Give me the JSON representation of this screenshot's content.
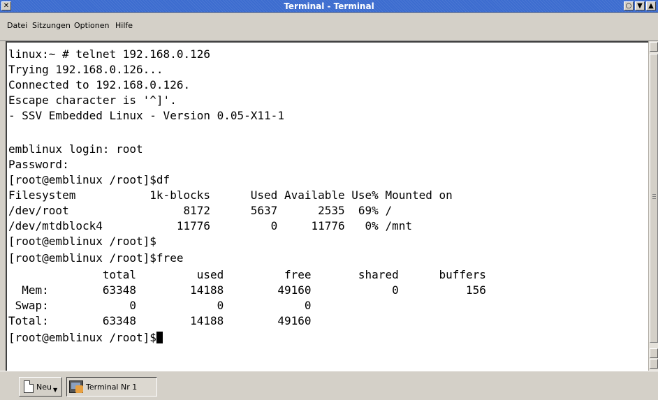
{
  "window": {
    "title": "Terminal - Terminal",
    "close_glyph": "✕",
    "buttons": [
      "○",
      "▼",
      "▲"
    ]
  },
  "menu": {
    "items": [
      "Datei",
      "Sitzungen",
      "Optionen",
      "Hilfe"
    ]
  },
  "terminal": {
    "lines": [
      "linux:~ # telnet 192.168.0.126",
      "Trying 192.168.0.126...",
      "Connected to 192.168.0.126.",
      "Escape character is '^]'.",
      "- SSV Embedded Linux - Version 0.05-X11-1",
      "",
      "emblinux login: root",
      "Password:",
      "[root@emblinux /root]$df",
      "Filesystem           1k-blocks      Used Available Use% Mounted on",
      "/dev/root                 8172      5637      2535  69% /",
      "/dev/mtdblock4           11776         0     11776   0% /mnt",
      "[root@emblinux /root]$",
      "[root@emblinux /root]$free",
      "              total         used         free       shared      buffers",
      "  Mem:        63348        14188        49160            0          156",
      " Swap:            0            0            0",
      "Total:        63348        14188        49160",
      "[root@emblinux /root]$"
    ]
  },
  "tabs": {
    "new_label": "Neu",
    "session_label": "Terminal Nr 1"
  },
  "colors": {
    "titlebar": "#3c6ccf",
    "background": "#d4d0c8",
    "terminal_bg": "#ffffff",
    "terminal_fg": "#000000"
  }
}
